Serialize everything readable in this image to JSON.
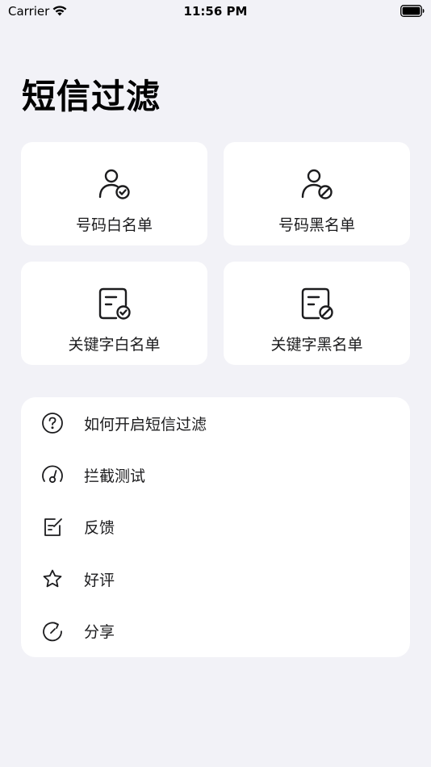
{
  "status_bar": {
    "carrier": "Carrier",
    "time": "11:56 PM"
  },
  "page_title": "短信过滤",
  "cards": [
    {
      "label": "号码白名单",
      "icon": "user-check-icon"
    },
    {
      "label": "号码黑名单",
      "icon": "user-block-icon"
    },
    {
      "label": "关键字白名单",
      "icon": "document-check-icon"
    },
    {
      "label": "关键字黑名单",
      "icon": "document-block-icon"
    }
  ],
  "menu": [
    {
      "label": "如何开启短信过滤",
      "icon": "question-circle-icon"
    },
    {
      "label": "拦截测试",
      "icon": "gauge-icon"
    },
    {
      "label": "反馈",
      "icon": "edit-note-icon"
    },
    {
      "label": "好评",
      "icon": "star-icon"
    },
    {
      "label": "分享",
      "icon": "share-refresh-icon"
    }
  ],
  "colors": {
    "background": "#F2F2F7",
    "card": "#FFFFFF",
    "text": "#1C1C1E"
  }
}
